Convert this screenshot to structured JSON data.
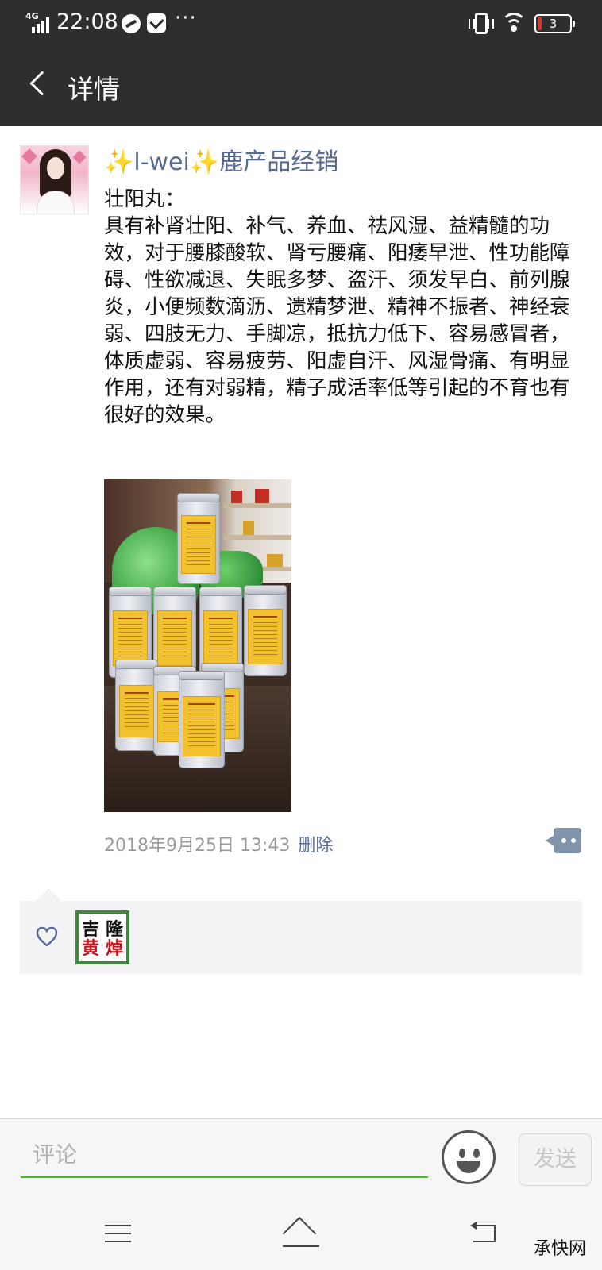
{
  "status_bar": {
    "network": "4G",
    "time": "22:08",
    "battery": "3"
  },
  "header": {
    "title": "详情"
  },
  "post": {
    "author": {
      "sparkle_left": "✨",
      "name": "l-wei",
      "sparkle_right": "✨",
      "suffix": "鹿产品经销"
    },
    "content": "壮阳丸：\n具有补肾壮阳、补气、养血、祛风湿、益精髓的功效，对于腰膝酸软、肾亏腰痛、阳痿早泄、性功能障碍、性欲减退、失眠多梦、盗汗、须发早白、前列腺炎，小便频数滴沥、遗精梦泄、精神不振者、神经衰弱、四肢无力、手脚凉，抵抗力低下、容易感冒者，体质虚弱、容易疲劳、阳虚自汗、风湿骨痛、有明显作用，还有对弱精，精子成活率低等引起的不育也有很好的效果。",
    "timestamp": "2018年9月25日 13:43",
    "delete_label": "删除"
  },
  "likes": {
    "liker_avatar_text": [
      "吉",
      "隆",
      "黄",
      "焯"
    ]
  },
  "comment_bar": {
    "placeholder": "评论",
    "send_label": "发送"
  },
  "watermark": "承快网",
  "colors": {
    "bar_bg": "#2e2e2e",
    "link_blue": "#576b95",
    "input_green": "#45c01a",
    "likes_bg": "#f3f3f5"
  }
}
